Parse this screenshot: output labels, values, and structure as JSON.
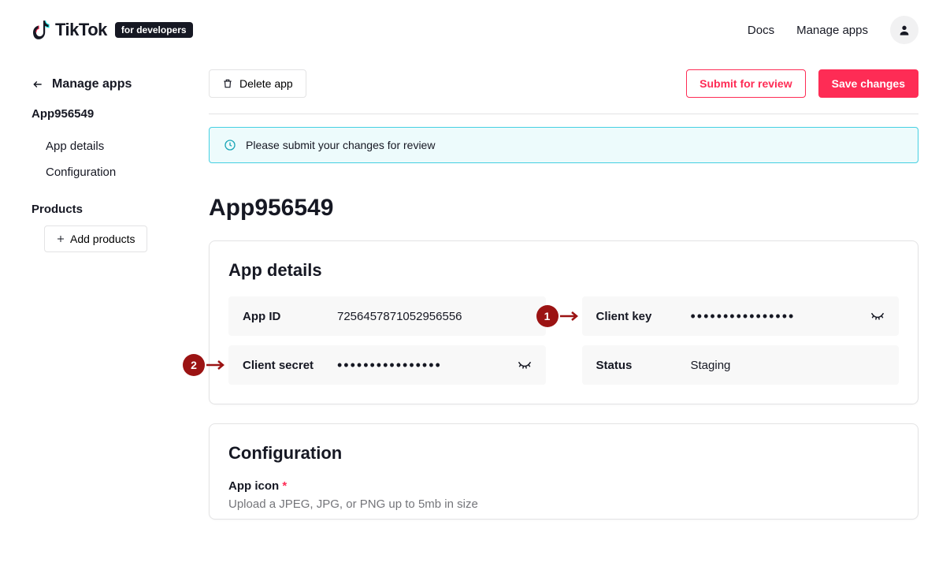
{
  "header": {
    "brand_text": "TikTok",
    "brand_badge": "for developers",
    "nav": {
      "docs": "Docs",
      "manage_apps": "Manage apps"
    }
  },
  "sidebar": {
    "back_label": "Manage apps",
    "app_name": "App956549",
    "items": [
      "App details",
      "Configuration"
    ],
    "products_label": "Products",
    "add_products": "Add products"
  },
  "actions": {
    "delete": "Delete app",
    "submit": "Submit for review",
    "save": "Save changes"
  },
  "notice": "Please submit your changes for review",
  "app_title": "App956549",
  "details": {
    "heading": "App details",
    "fields": {
      "app_id": {
        "label": "App ID",
        "value": "7256457871052956556"
      },
      "client_key": {
        "label": "Client key",
        "value": "••••••••••••••••"
      },
      "client_secret": {
        "label": "Client secret",
        "value": "••••••••••••••••"
      },
      "status": {
        "label": "Status",
        "value": "Staging"
      }
    }
  },
  "configuration": {
    "heading": "Configuration",
    "app_icon_label": "App icon",
    "required": "*",
    "app_icon_help": "Upload a JPEG, JPG, or PNG up to 5mb in size"
  },
  "callouts": {
    "one": "1",
    "two": "2"
  }
}
